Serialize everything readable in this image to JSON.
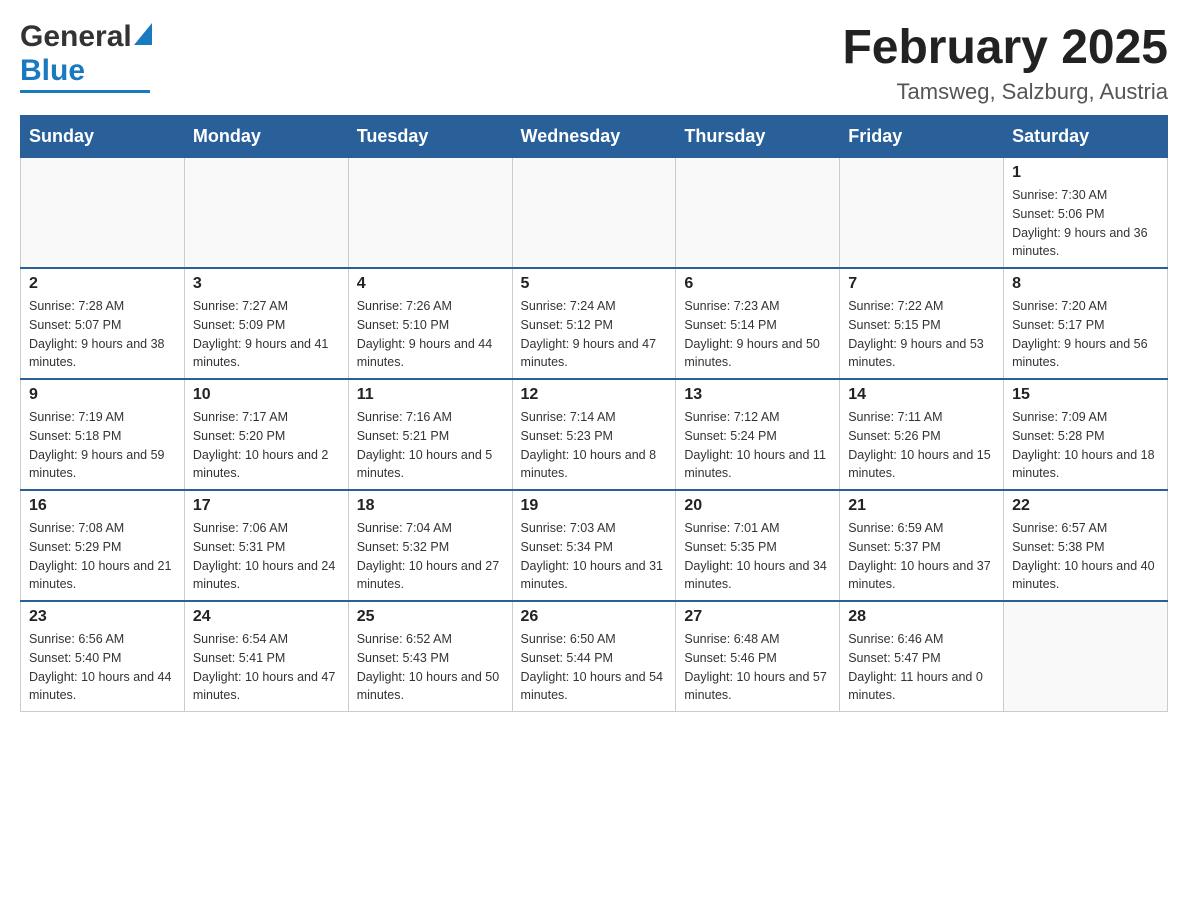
{
  "header": {
    "logo": {
      "general": "General",
      "blue": "Blue",
      "tagline": "GeneralBlue"
    },
    "month": "February 2025",
    "location": "Tamsweg, Salzburg, Austria"
  },
  "days_of_week": [
    "Sunday",
    "Monday",
    "Tuesday",
    "Wednesday",
    "Thursday",
    "Friday",
    "Saturday"
  ],
  "weeks": [
    {
      "days": [
        {
          "date": "",
          "info": ""
        },
        {
          "date": "",
          "info": ""
        },
        {
          "date": "",
          "info": ""
        },
        {
          "date": "",
          "info": ""
        },
        {
          "date": "",
          "info": ""
        },
        {
          "date": "",
          "info": ""
        },
        {
          "date": "1",
          "info": "Sunrise: 7:30 AM\nSunset: 5:06 PM\nDaylight: 9 hours and 36 minutes."
        }
      ]
    },
    {
      "days": [
        {
          "date": "2",
          "info": "Sunrise: 7:28 AM\nSunset: 5:07 PM\nDaylight: 9 hours and 38 minutes."
        },
        {
          "date": "3",
          "info": "Sunrise: 7:27 AM\nSunset: 5:09 PM\nDaylight: 9 hours and 41 minutes."
        },
        {
          "date": "4",
          "info": "Sunrise: 7:26 AM\nSunset: 5:10 PM\nDaylight: 9 hours and 44 minutes."
        },
        {
          "date": "5",
          "info": "Sunrise: 7:24 AM\nSunset: 5:12 PM\nDaylight: 9 hours and 47 minutes."
        },
        {
          "date": "6",
          "info": "Sunrise: 7:23 AM\nSunset: 5:14 PM\nDaylight: 9 hours and 50 minutes."
        },
        {
          "date": "7",
          "info": "Sunrise: 7:22 AM\nSunset: 5:15 PM\nDaylight: 9 hours and 53 minutes."
        },
        {
          "date": "8",
          "info": "Sunrise: 7:20 AM\nSunset: 5:17 PM\nDaylight: 9 hours and 56 minutes."
        }
      ]
    },
    {
      "days": [
        {
          "date": "9",
          "info": "Sunrise: 7:19 AM\nSunset: 5:18 PM\nDaylight: 9 hours and 59 minutes."
        },
        {
          "date": "10",
          "info": "Sunrise: 7:17 AM\nSunset: 5:20 PM\nDaylight: 10 hours and 2 minutes."
        },
        {
          "date": "11",
          "info": "Sunrise: 7:16 AM\nSunset: 5:21 PM\nDaylight: 10 hours and 5 minutes."
        },
        {
          "date": "12",
          "info": "Sunrise: 7:14 AM\nSunset: 5:23 PM\nDaylight: 10 hours and 8 minutes."
        },
        {
          "date": "13",
          "info": "Sunrise: 7:12 AM\nSunset: 5:24 PM\nDaylight: 10 hours and 11 minutes."
        },
        {
          "date": "14",
          "info": "Sunrise: 7:11 AM\nSunset: 5:26 PM\nDaylight: 10 hours and 15 minutes."
        },
        {
          "date": "15",
          "info": "Sunrise: 7:09 AM\nSunset: 5:28 PM\nDaylight: 10 hours and 18 minutes."
        }
      ]
    },
    {
      "days": [
        {
          "date": "16",
          "info": "Sunrise: 7:08 AM\nSunset: 5:29 PM\nDaylight: 10 hours and 21 minutes."
        },
        {
          "date": "17",
          "info": "Sunrise: 7:06 AM\nSunset: 5:31 PM\nDaylight: 10 hours and 24 minutes."
        },
        {
          "date": "18",
          "info": "Sunrise: 7:04 AM\nSunset: 5:32 PM\nDaylight: 10 hours and 27 minutes."
        },
        {
          "date": "19",
          "info": "Sunrise: 7:03 AM\nSunset: 5:34 PM\nDaylight: 10 hours and 31 minutes."
        },
        {
          "date": "20",
          "info": "Sunrise: 7:01 AM\nSunset: 5:35 PM\nDaylight: 10 hours and 34 minutes."
        },
        {
          "date": "21",
          "info": "Sunrise: 6:59 AM\nSunset: 5:37 PM\nDaylight: 10 hours and 37 minutes."
        },
        {
          "date": "22",
          "info": "Sunrise: 6:57 AM\nSunset: 5:38 PM\nDaylight: 10 hours and 40 minutes."
        }
      ]
    },
    {
      "days": [
        {
          "date": "23",
          "info": "Sunrise: 6:56 AM\nSunset: 5:40 PM\nDaylight: 10 hours and 44 minutes."
        },
        {
          "date": "24",
          "info": "Sunrise: 6:54 AM\nSunset: 5:41 PM\nDaylight: 10 hours and 47 minutes."
        },
        {
          "date": "25",
          "info": "Sunrise: 6:52 AM\nSunset: 5:43 PM\nDaylight: 10 hours and 50 minutes."
        },
        {
          "date": "26",
          "info": "Sunrise: 6:50 AM\nSunset: 5:44 PM\nDaylight: 10 hours and 54 minutes."
        },
        {
          "date": "27",
          "info": "Sunrise: 6:48 AM\nSunset: 5:46 PM\nDaylight: 10 hours and 57 minutes."
        },
        {
          "date": "28",
          "info": "Sunrise: 6:46 AM\nSunset: 5:47 PM\nDaylight: 11 hours and 0 minutes."
        },
        {
          "date": "",
          "info": ""
        }
      ]
    }
  ]
}
